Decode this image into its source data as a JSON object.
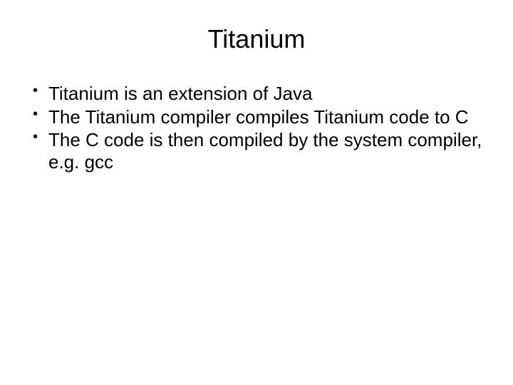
{
  "slide": {
    "title": "Titanium",
    "bullets": [
      "Titanium is an extension of Java",
      "The Titanium compiler compiles Titanium code to C",
      "The C code is then compiled by the system compiler, e.g. gcc"
    ]
  }
}
